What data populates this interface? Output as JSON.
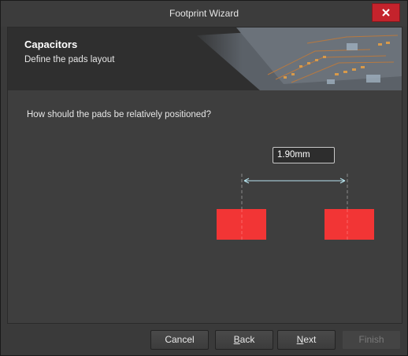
{
  "window": {
    "title": "Footprint Wizard"
  },
  "header": {
    "title": "Capacitors",
    "subtitle": "Define the pads layout"
  },
  "main": {
    "question": "How should the pads be relatively positioned?",
    "pad_spacing_value": "1.90mm",
    "pad_color": "#f23535"
  },
  "footer": {
    "cancel_label": "Cancel",
    "back_first_letter": "B",
    "back_rest": "ack",
    "next_first_letter": "N",
    "next_rest": "ext",
    "finish_label": "Finish"
  },
  "icons": {
    "close": "close-icon"
  }
}
